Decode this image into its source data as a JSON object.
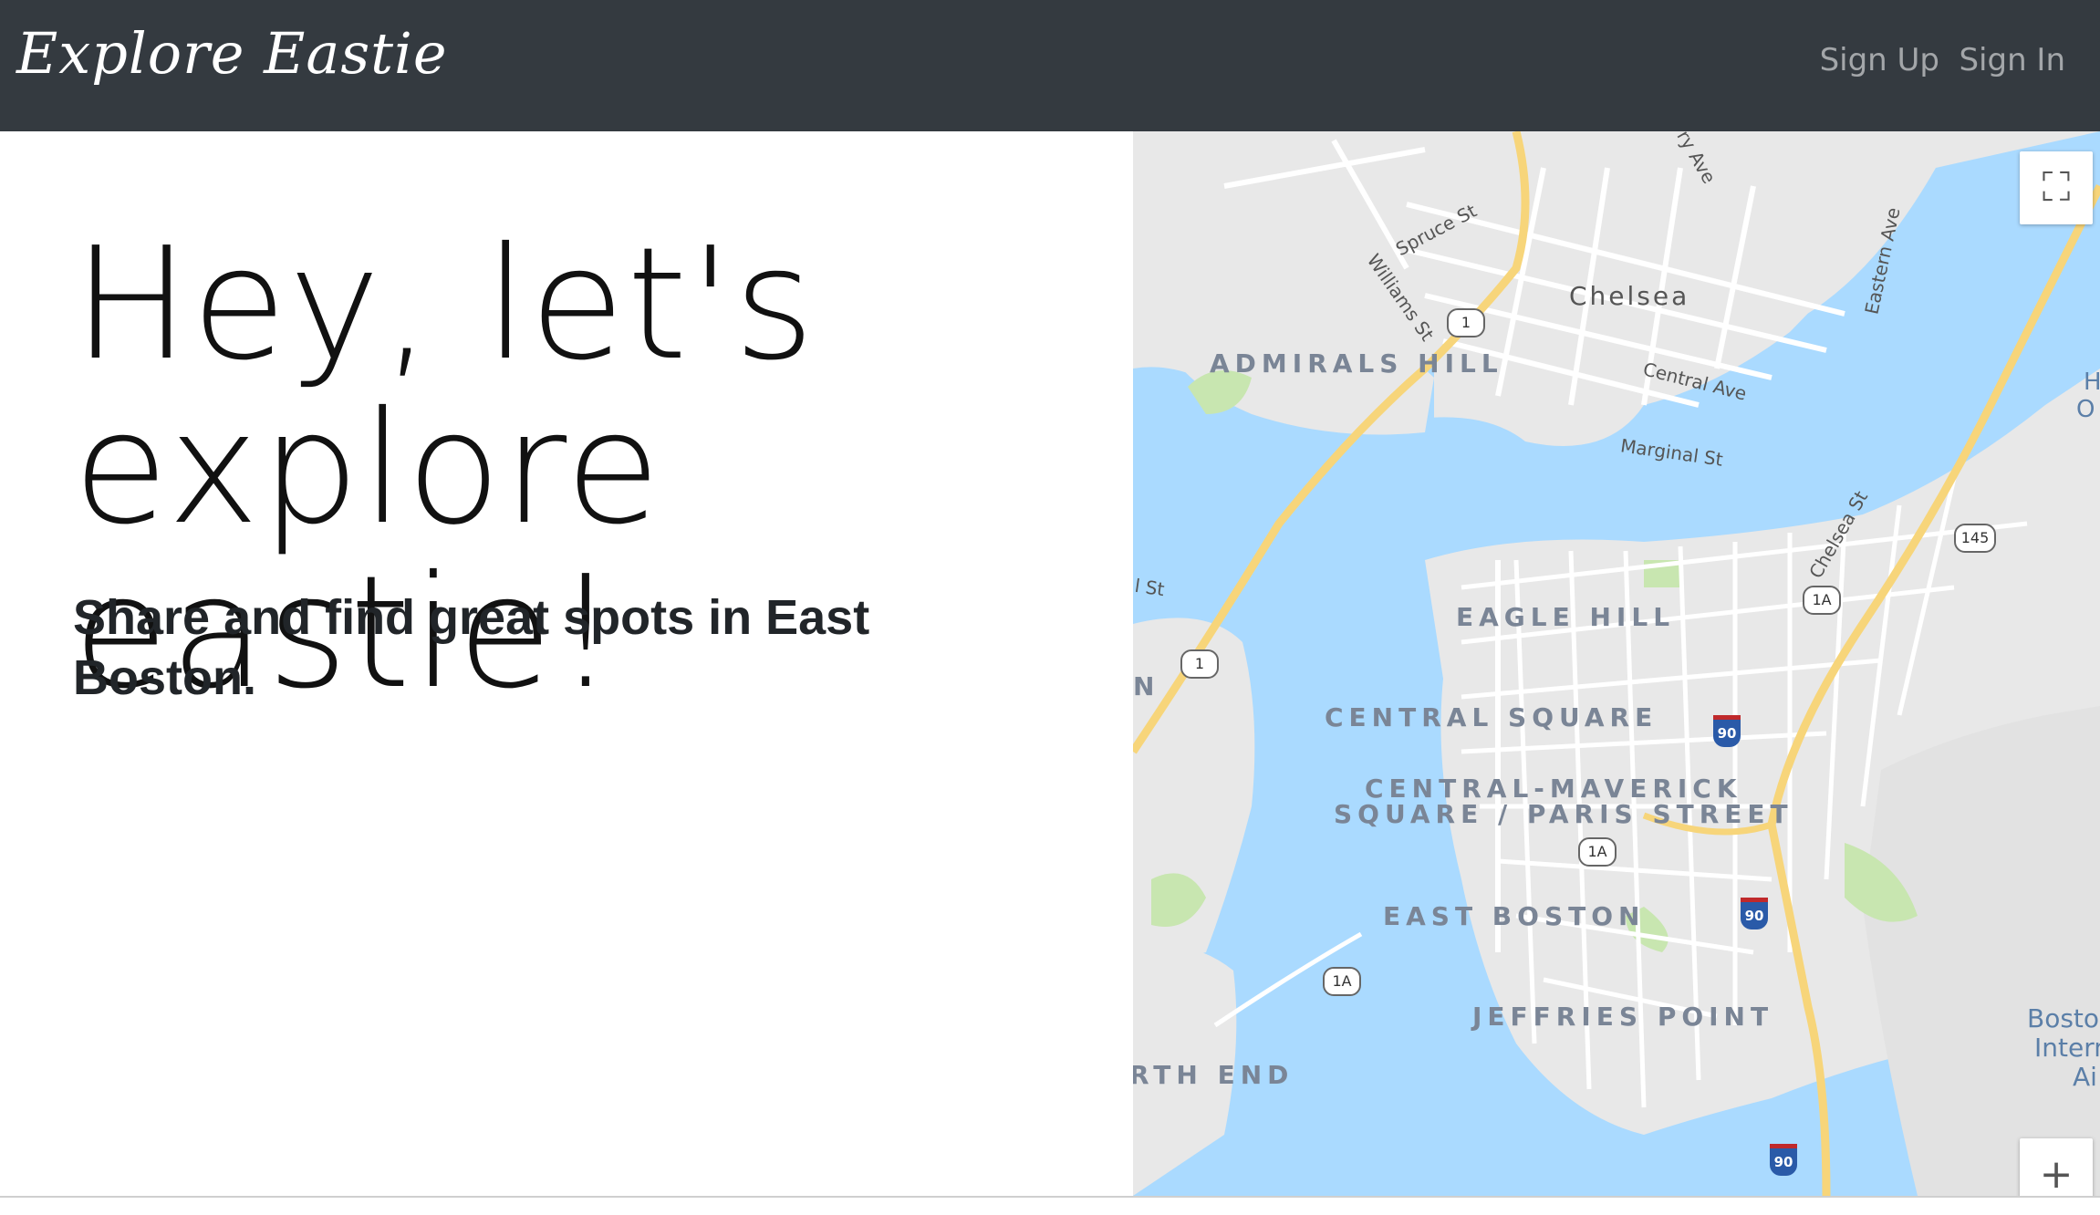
{
  "navbar": {
    "brand": "Explore Eastie",
    "links": [
      {
        "label": "Sign Up"
      },
      {
        "label": "Sign In"
      }
    ],
    "background": "#343a40"
  },
  "hero": {
    "title": "Hey, let's explore eastie!",
    "subtitle": "Share and find great spots in East Boston."
  },
  "map": {
    "neighborhoods": [
      "ADMIRALS HILL",
      "EAGLE HILL",
      "CENTRAL SQUARE",
      "CENTRAL-MAVERICK",
      "SQUARE / PARIS STREET",
      "EAST BOSTON",
      "JEFFRIES POINT",
      "RTH END",
      "N"
    ],
    "city": "Chelsea",
    "streets": [
      "Spruce St",
      "Williams St",
      "Central Ave",
      "Marginal St",
      "Eastern Ave",
      "Chelsea St",
      "ry Ave",
      "l St"
    ],
    "routes": [
      "1",
      "1",
      "1A",
      "1A",
      "1A",
      "145"
    ],
    "interstates": [
      "90",
      "90",
      "90"
    ],
    "airport_label": [
      "Bosto",
      "Intern",
      "Ai"
    ],
    "edge_label": [
      "H",
      "O"
    ],
    "controls": {
      "fullscreen_icon": "⛶",
      "zoom_in_icon": "+"
    },
    "colors": {
      "water": "#aadaff",
      "land": "#e8e8e8",
      "park": "#c8e6b0",
      "highway": "#f7d57a"
    }
  }
}
